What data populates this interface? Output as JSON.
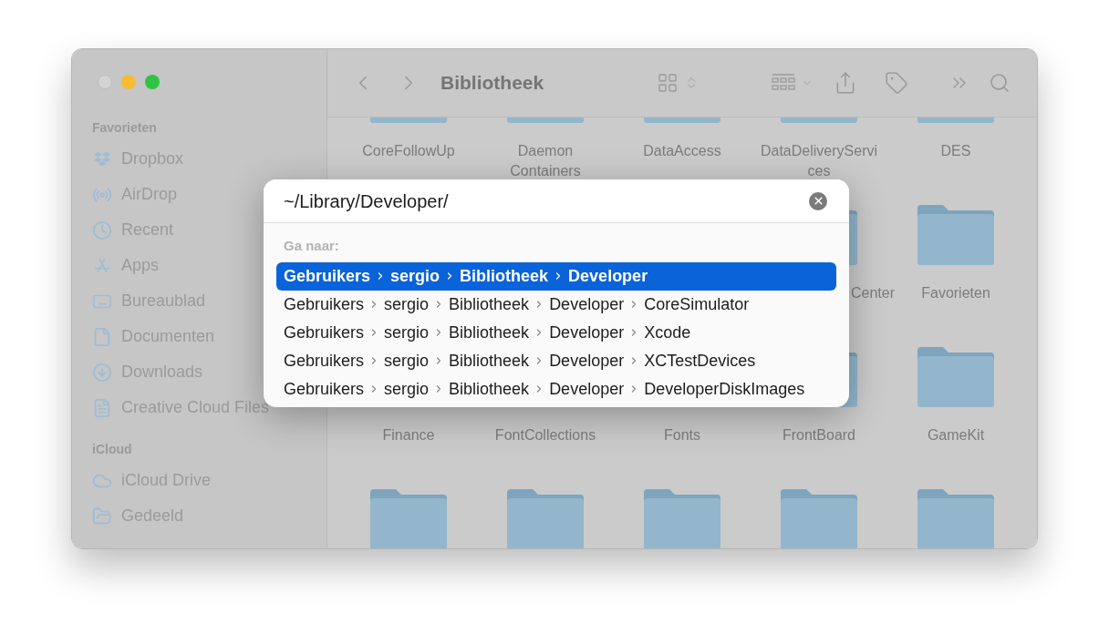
{
  "window": {
    "title": "Bibliotheek"
  },
  "sidebar": {
    "sections": [
      {
        "heading": "Favorieten",
        "items": [
          {
            "label": "Dropbox"
          },
          {
            "label": "AirDrop"
          },
          {
            "label": "Recent"
          },
          {
            "label": "Apps"
          },
          {
            "label": "Bureaublad"
          },
          {
            "label": "Documenten"
          },
          {
            "label": "Downloads"
          },
          {
            "label": "Creative Cloud Files"
          }
        ]
      },
      {
        "heading": "iCloud",
        "items": [
          {
            "label": "iCloud Drive"
          },
          {
            "label": "Gedeeld"
          }
        ]
      }
    ]
  },
  "file_rows": [
    [
      {
        "label": "CoreFollowUp"
      },
      {
        "label": "Daemon Containers"
      },
      {
        "label": "DataAccess"
      },
      {
        "label": "DataDeliveryServices"
      },
      {
        "label": "DES"
      }
    ],
    [
      {
        "kind": "hidden"
      },
      {
        "kind": "hidden"
      },
      {
        "kind": "hidden"
      },
      {
        "kind": "cut",
        "label": "Center"
      },
      {
        "label": "Favorieten"
      }
    ],
    [
      {
        "label": "Finance"
      },
      {
        "label": "FontCollections"
      },
      {
        "label": "Fonts"
      },
      {
        "label": "FrontBoard"
      },
      {
        "label": "GameKit"
      }
    ],
    [
      {},
      {},
      {},
      {},
      {}
    ]
  ],
  "go_to_dialog": {
    "value": "~/Library/Developer/",
    "heading": "Ga naar:",
    "results": [
      {
        "selected": true,
        "path": [
          "Gebruikers",
          "sergio",
          "Bibliotheek",
          "Developer"
        ]
      },
      {
        "selected": false,
        "path": [
          "Gebruikers",
          "sergio",
          "Bibliotheek",
          "Developer",
          "CoreSimulator"
        ]
      },
      {
        "selected": false,
        "path": [
          "Gebruikers",
          "sergio",
          "Bibliotheek",
          "Developer",
          "Xcode"
        ]
      },
      {
        "selected": false,
        "path": [
          "Gebruikers",
          "sergio",
          "Bibliotheek",
          "Developer",
          "XCTestDevices"
        ]
      },
      {
        "selected": false,
        "path": [
          "Gebruikers",
          "sergio",
          "Bibliotheek",
          "Developer",
          "DeveloperDiskImages"
        ]
      }
    ]
  }
}
